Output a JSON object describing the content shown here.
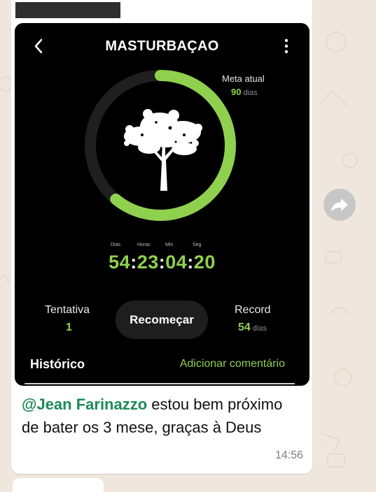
{
  "app": {
    "title": "MASTURBAÇAO",
    "goal": {
      "label": "Meta atual",
      "value": "90",
      "unit": "dias"
    },
    "progress": 0.61,
    "timer": {
      "labels": [
        "Dias",
        "Horas",
        "Min",
        "Seg"
      ],
      "days": "54",
      "hours": "23",
      "minutes": "04",
      "seconds": "20"
    },
    "attempts": {
      "label": "Tentativa",
      "value": "1"
    },
    "restart_label": "Recomeçar",
    "record": {
      "label": "Record",
      "value": "54",
      "unit": "dias"
    },
    "history_label": "Histórico",
    "add_comment_label": "Adicionar comentário"
  },
  "message": {
    "mention": "@Jean Farinazzo",
    "text": " estou bem próximo de bater os 3 mese, graças à Deus",
    "time": "14:56"
  },
  "colors": {
    "accent": "#8fd14f",
    "mention": "#1d8a56",
    "chat_bg": "#efe7dd"
  },
  "icons": {
    "back": "chevron-left-icon",
    "menu": "kebab-menu-icon",
    "forward": "forward-arrow-icon",
    "tree": "tree-icon"
  }
}
